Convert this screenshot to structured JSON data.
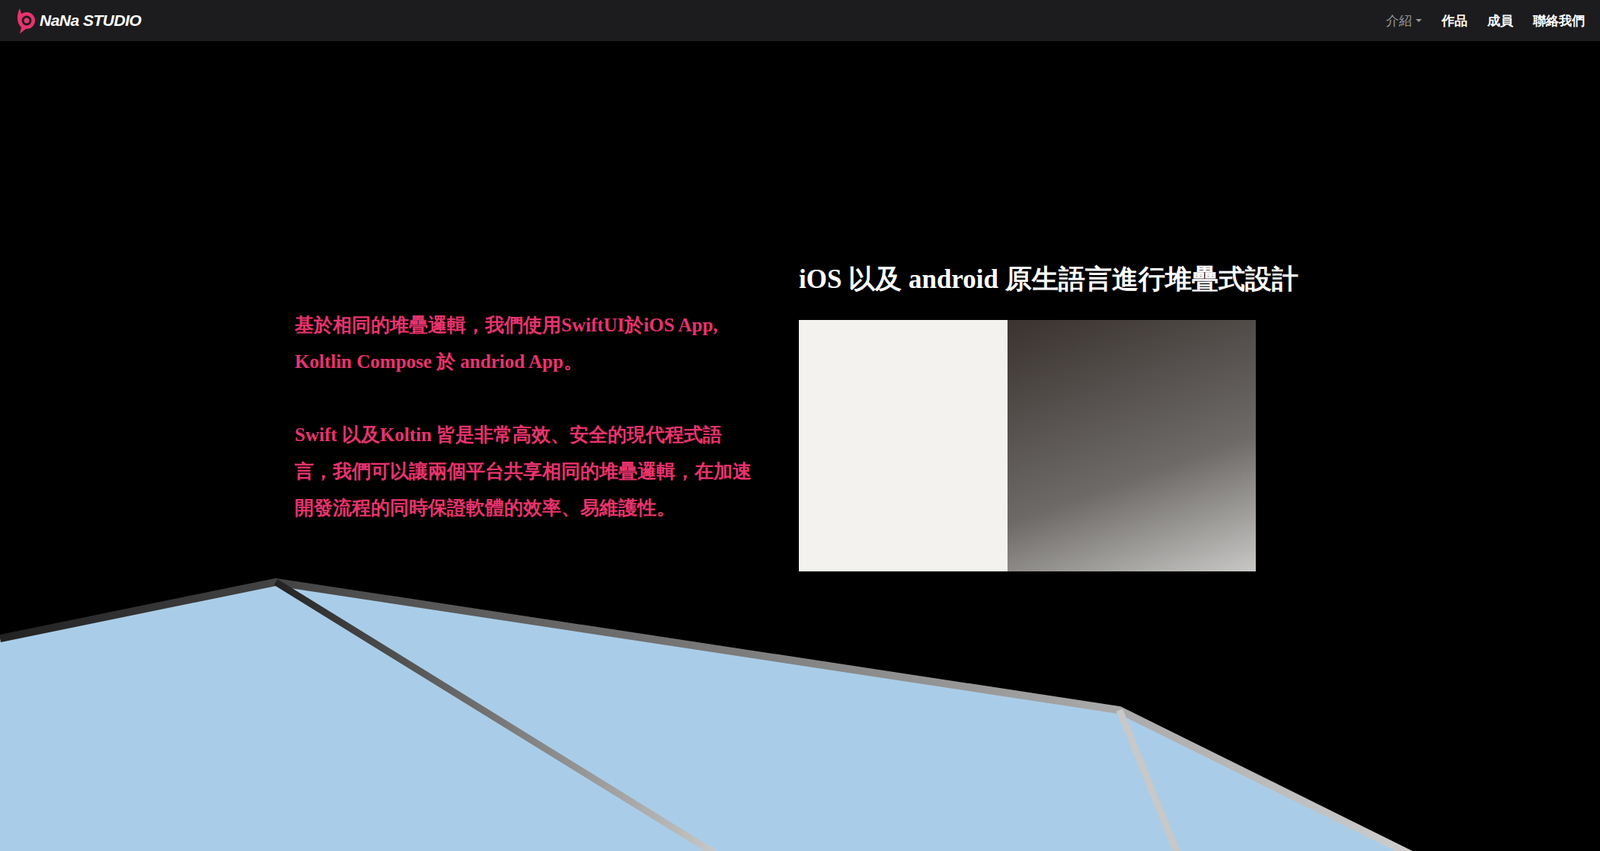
{
  "navbar": {
    "logo": "NaNa STUDIO",
    "items": [
      {
        "label": "介紹",
        "dropdown": true,
        "muted": true
      },
      {
        "label": "作品",
        "dropdown": false,
        "muted": false
      },
      {
        "label": "成員",
        "dropdown": false,
        "muted": false
      },
      {
        "label": "聯絡我們",
        "dropdown": false,
        "muted": false
      }
    ]
  },
  "hero": {
    "title": "iOS 以及 android 原生語言進行堆疊式設計",
    "paragraphs": [
      "基於相同的堆疊邏輯，我們使用SwiftUI於iOS App, Koltlin Compose 於 andriod App。",
      "Swift 以及Koltin 皆是非常高效、安全的現代程式語言，我們可以讓兩個平台共享相同的堆疊邏輯，在加速開發流程的同時保證軟體的效率、易維護性。"
    ]
  }
}
